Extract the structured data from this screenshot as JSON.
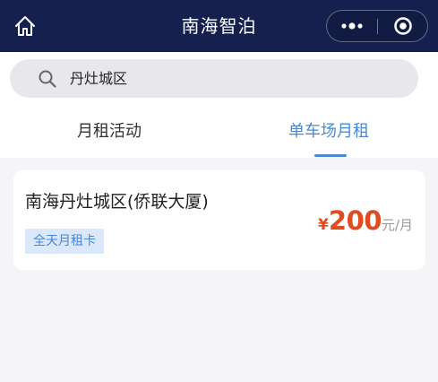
{
  "header": {
    "title": "南海智泊",
    "home_icon": "home-icon",
    "more_icon": "more-dots-icon",
    "close_icon": "target-close-icon"
  },
  "search": {
    "value": "丹灶城区",
    "icon": "search-icon"
  },
  "tabs": [
    {
      "label": "月租活动",
      "active": false
    },
    {
      "label": "单车场月租",
      "active": true
    }
  ],
  "lots": [
    {
      "name": "南海丹灶城区(侨联大厦)",
      "badge": "全天月租卡",
      "currency": "¥",
      "price": "200",
      "unit": "元/月"
    }
  ],
  "colors": {
    "header_bg": "#16204e",
    "accent": "#4a8ad4",
    "price": "#e24a1f",
    "badge_bg": "#dbe7fb",
    "page_bg": "#f5f5f7"
  }
}
